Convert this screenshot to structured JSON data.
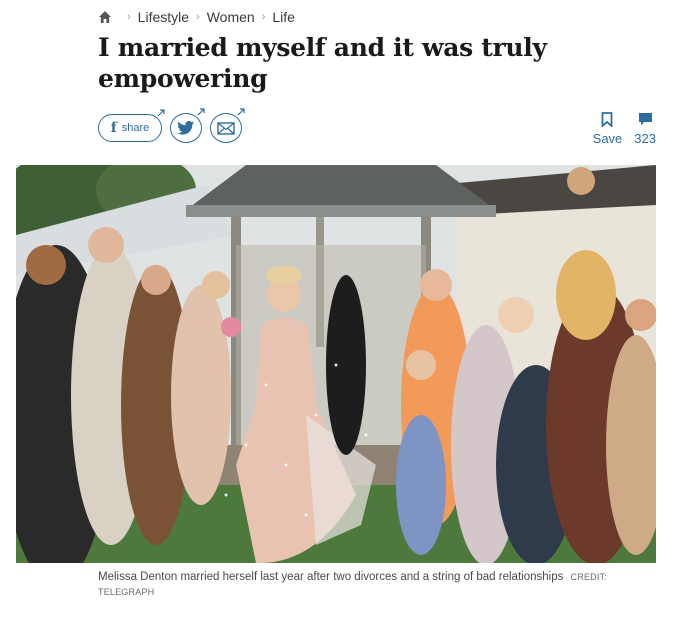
{
  "breadcrumb": {
    "home_icon": "home-icon",
    "items": [
      "Lifestyle",
      "Women",
      "Life"
    ]
  },
  "headline": "I married myself and it was truly empowering",
  "share": {
    "facebook_label": "share",
    "icons": [
      "facebook-icon",
      "twitter-icon",
      "email-icon"
    ]
  },
  "actions": {
    "save_label": "Save",
    "comments_count": "323"
  },
  "image": {
    "alt": "Woman in a blush wedding dress walking through a crowd of guests throwing confetti",
    "caption": "Melissa Denton married herself last year after two divorces and a string of bad relationships",
    "credit_label": "CREDIT:",
    "credit": "TELEGRAPH"
  },
  "colors": {
    "accent": "#2d6c9e",
    "text": "#1a1a1a"
  }
}
